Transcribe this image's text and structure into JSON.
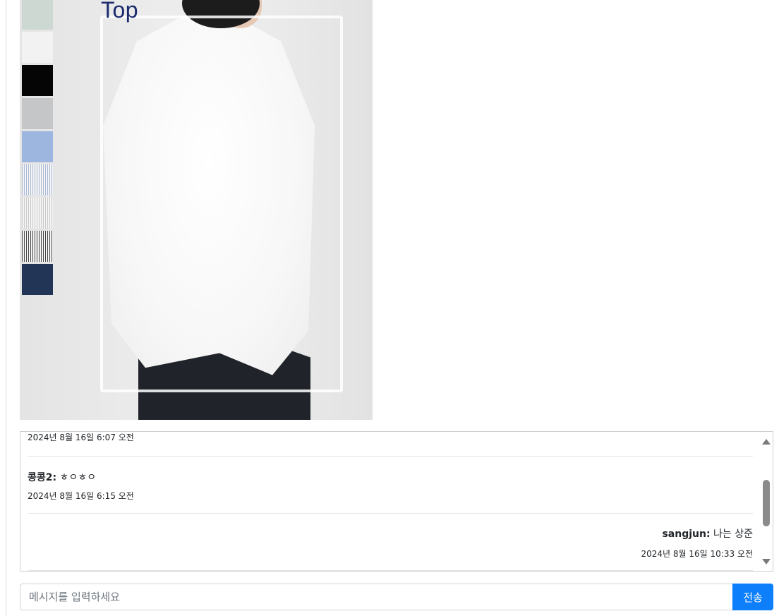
{
  "product": {
    "detection_label": "Top",
    "swatches": [
      {
        "name": "mint-gray",
        "color": "#cdd8d3",
        "pattern": "solid"
      },
      {
        "name": "off-white",
        "color": "#f3f2f2",
        "pattern": "solid"
      },
      {
        "name": "black",
        "color": "#050505",
        "pattern": "solid"
      },
      {
        "name": "light-gray",
        "color": "#c5c6c8",
        "pattern": "solid"
      },
      {
        "name": "light-blue",
        "color": "#9db6df",
        "pattern": "solid"
      },
      {
        "name": "blue-stripe",
        "color": "#a9b8d6",
        "pattern": "stripe"
      },
      {
        "name": "gray-stripe",
        "color": "#c9c9c9",
        "pattern": "stripe"
      },
      {
        "name": "black-stripe",
        "color": "#444444",
        "pattern": "stripe"
      },
      {
        "name": "navy",
        "color": "#233556",
        "pattern": "solid"
      }
    ]
  },
  "chat": {
    "messages": [
      {
        "user": "",
        "text": "",
        "time": "2024년 8월 16일 6:07 오전",
        "align": "left"
      },
      {
        "user": "콩콩2:",
        "text": "ㅎㅇㅎㅇ",
        "time": "2024년 8월 16일 6:15 오전",
        "align": "left"
      },
      {
        "user": "sangjun:",
        "text": "나는 상준",
        "time": "2024년 8월 16일 10:33 오전",
        "align": "right"
      }
    ]
  },
  "composer": {
    "placeholder": "메시지를 입력하세요",
    "value": "",
    "send_label": "전송"
  }
}
